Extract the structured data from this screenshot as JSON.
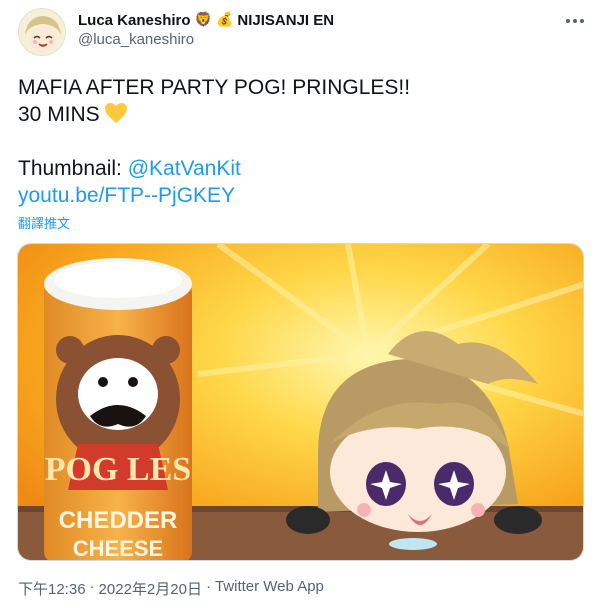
{
  "author": {
    "display_name": "Luca Kaneshiro",
    "badges": [
      "🦁",
      "💰"
    ],
    "affiliation": "NIJISANJI EN",
    "handle": "@luca_kaneshiro"
  },
  "tweet": {
    "line1": "MAFIA AFTER PARTY POG! PRINGLES!!",
    "line2": "30 MINS",
    "thumbnail_label": "Thumbnail: ",
    "thumbnail_mention": "@KatVanKit",
    "url": "youtu.be/FTP--PjGKEY",
    "translate_label": "翻譯推文"
  },
  "media": {
    "can_text_top": "POG LES",
    "can_text_bottom": "CHEDDER",
    "can_text_bottom2": "CHEESE",
    "heart_color": "#ffc83d",
    "link_color": "#1d9bf0"
  },
  "footer": {
    "time": "下午12:36",
    "separator": "·",
    "date": "2022年2月20日",
    "source": "Twitter Web App"
  },
  "icons": {
    "more": "more-dots-icon",
    "heart": "yellow-heart-icon"
  }
}
